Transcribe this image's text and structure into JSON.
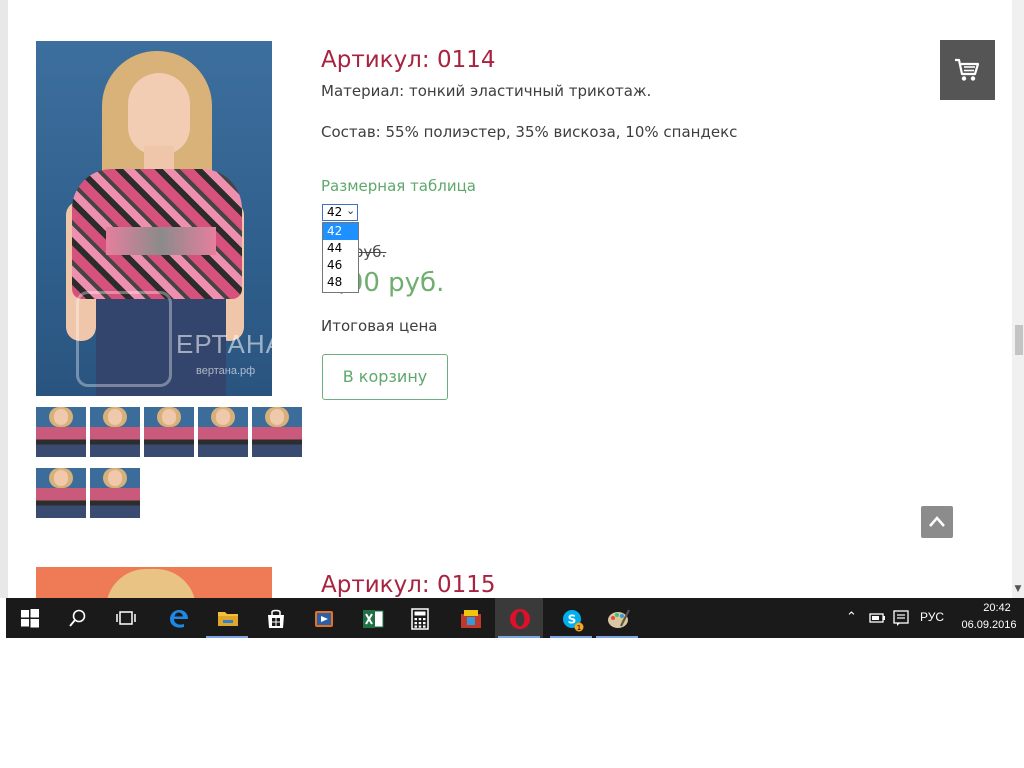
{
  "product": {
    "title": "Артикул: 0114",
    "material": "Материал: тонкий эластичный трикотаж.",
    "composition": "Состав: 55% полиэстер, 35% вискоза, 10% спандекс",
    "size_table_link": "Размерная таблица",
    "size_selected": "42",
    "size_options": [
      "42",
      "44",
      "46",
      "48"
    ],
    "old_price": "00 руб.",
    "new_price": "0,00 руб.",
    "total_label": "Итоговая цена",
    "cart_button": "В корзину",
    "watermark": {
      "brand": "ЕРТАНА",
      "site": "вертана.рф"
    },
    "thumbnail_count": 7
  },
  "next_product": {
    "title": "Артикул: 0115"
  },
  "widgets": {
    "cart_icon": "cart-icon",
    "scroll_top_icon": "chevron-up-icon"
  },
  "taskbar": {
    "apps": [
      "windows-start",
      "search",
      "task-view",
      "edge",
      "file-explorer",
      "store",
      "media-player",
      "excel",
      "calculator",
      "archive",
      "opera",
      "skype",
      "paint"
    ],
    "skype_badge": "1",
    "language": "РУС",
    "time": "20:42",
    "date": "06.09.2016"
  },
  "colors": {
    "title": "#a8233f",
    "accent_green": "#5ea86b",
    "dropdown_highlight": "#1e90ff",
    "taskbar": "#1a1a1a"
  }
}
